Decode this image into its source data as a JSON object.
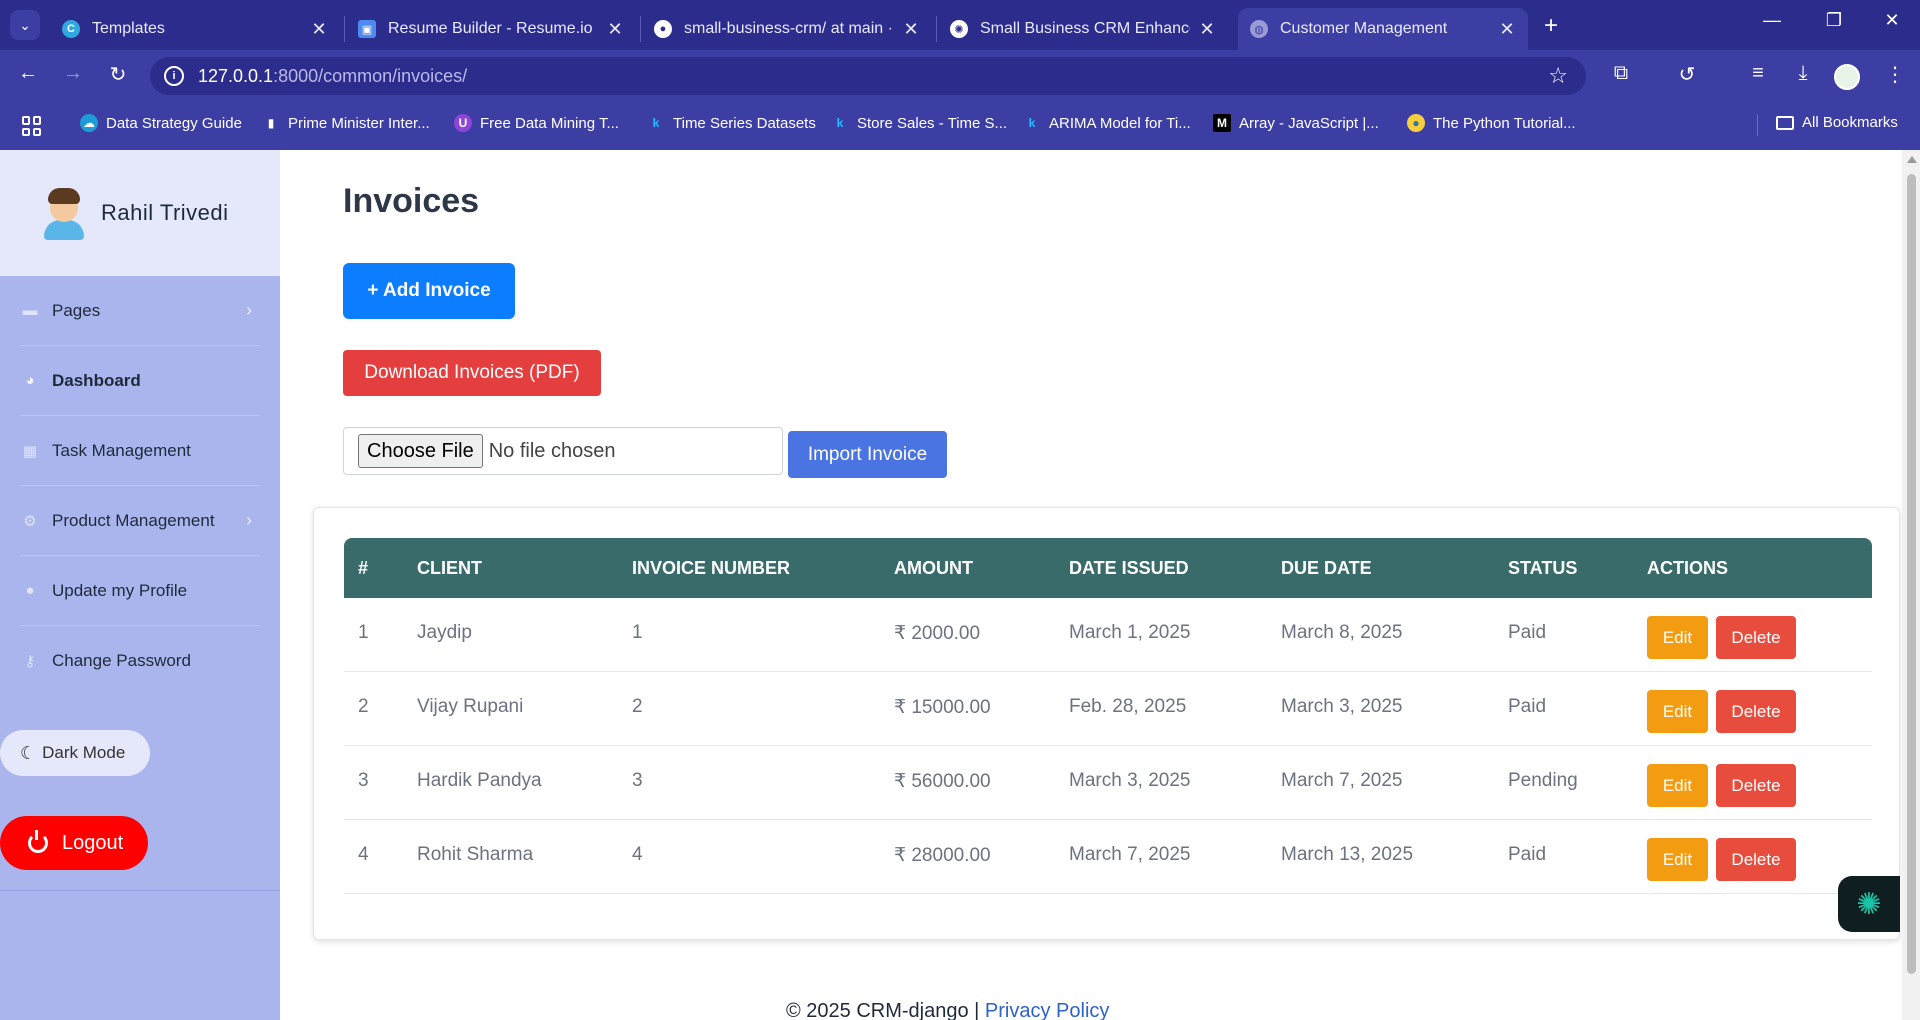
{
  "browser": {
    "tabs": [
      {
        "title": "Templates",
        "active": false
      },
      {
        "title": "Resume Builder - Resume.io",
        "active": false
      },
      {
        "title": "small-business-crm/ at main · ra",
        "active": false
      },
      {
        "title": "Small Business CRM Enhanceme",
        "active": false
      },
      {
        "title": "Customer Management",
        "active": true
      }
    ],
    "url_host": "127.0.0.1",
    "url_path": ":8000/common/invoices/",
    "bookmarks": [
      "Data Strategy Guide",
      "Prime Minister Inter...",
      "Free Data Mining T...",
      "Time Series Datasets",
      "Store Sales - Time S...",
      "ARIMA Model for Ti...",
      "Array - JavaScript |...",
      "The Python Tutorial..."
    ],
    "all_bookmarks": "All Bookmarks"
  },
  "sidebar": {
    "user_name": "Rahil Trivedi",
    "items": [
      {
        "label": "Pages",
        "icon": "folder-icon",
        "has_chevron": true
      },
      {
        "label": "Dashboard",
        "icon": "dashboard-icon",
        "has_chevron": false
      },
      {
        "label": "Task Management",
        "icon": "calendar-icon",
        "has_chevron": false
      },
      {
        "label": "Product Management",
        "icon": "cogs-icon",
        "has_chevron": true
      },
      {
        "label": "Update my Profile",
        "icon": "user-icon",
        "has_chevron": false
      },
      {
        "label": "Change Password",
        "icon": "key-icon",
        "has_chevron": false
      }
    ],
    "dark_mode_label": "Dark Mode",
    "logout_label": "Logout"
  },
  "main": {
    "title": "Invoices",
    "add_button": "+ Add Invoice",
    "pdf_button": "Download Invoices (PDF)",
    "choose_file": "Choose File",
    "no_file": "No file chosen",
    "import_button": "Import Invoice",
    "table": {
      "headers": [
        "#",
        "CLIENT",
        "INVOICE NUMBER",
        "AMOUNT",
        "DATE ISSUED",
        "DUE DATE",
        "STATUS",
        "ACTIONS"
      ],
      "rows": [
        {
          "id": "1",
          "client": "Jaydip",
          "invoice_number": "1",
          "amount": "₹ 2000.00",
          "date_issued": "March 1, 2025",
          "due_date": "March 8, 2025",
          "status": "Paid"
        },
        {
          "id": "2",
          "client": "Vijay Rupani",
          "invoice_number": "2",
          "amount": "₹ 15000.00",
          "date_issued": "Feb. 28, 2025",
          "due_date": "March 3, 2025",
          "status": "Paid"
        },
        {
          "id": "3",
          "client": "Hardik Pandya",
          "invoice_number": "3",
          "amount": "₹ 56000.00",
          "date_issued": "March 3, 2025",
          "due_date": "March 7, 2025",
          "status": "Pending"
        },
        {
          "id": "4",
          "client": "Rohit Sharma",
          "invoice_number": "4",
          "amount": "₹ 28000.00",
          "date_issued": "March 7, 2025",
          "due_date": "March 13, 2025",
          "status": "Paid"
        }
      ],
      "edit_label": "Edit",
      "delete_label": "Delete"
    }
  },
  "footer": {
    "copyright": "© 2025 CRM-django | ",
    "privacy": "Privacy Policy"
  },
  "colors": {
    "browser_frame": "#2b2c8c",
    "sidebar_bg": "#aab5ee",
    "table_header": "#3a6b6b",
    "add_button": "#0d7dff",
    "pdf_button": "#e53e3e",
    "import_button": "#4a74e2",
    "edit_button": "#f39c12",
    "delete_button": "#e74c3c",
    "logout_button": "#ff0000"
  }
}
